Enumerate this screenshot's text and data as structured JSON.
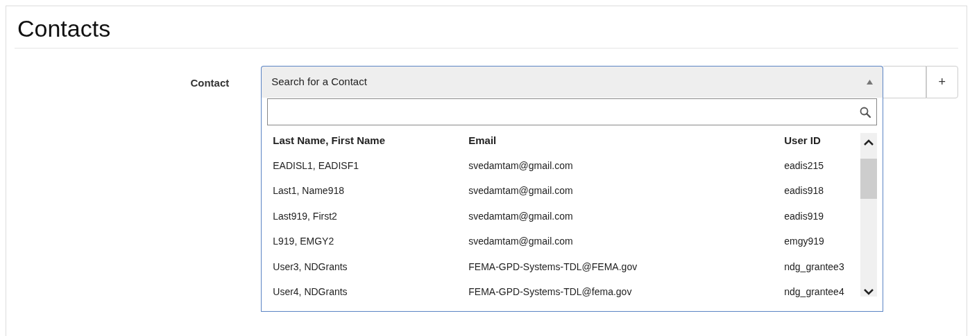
{
  "page": {
    "title": "Contacts"
  },
  "form": {
    "label": "Contact",
    "select": {
      "placeholder": "Search for a Contact",
      "expanded": true
    },
    "add_button": "+"
  },
  "dropdown": {
    "columns": [
      "Last Name, First Name",
      "Email",
      "User ID"
    ],
    "rows": [
      {
        "name": "EADISL1, EADISF1",
        "email": "svedamtam@gmail.com",
        "user_id": "eadis215"
      },
      {
        "name": "Last1, Name918",
        "email": "svedamtam@gmail.com",
        "user_id": "eadis918"
      },
      {
        "name": "Last919, First2",
        "email": "svedamtam@gmail.com",
        "user_id": "eadis919"
      },
      {
        "name": "L919, EMGY2",
        "email": "svedamtam@gmail.com",
        "user_id": "emgy919"
      },
      {
        "name": "User3, NDGrants",
        "email": "FEMA-GPD-Systems-TDL@FEMA.gov",
        "user_id": "ndg_grantee3"
      },
      {
        "name": "User4, NDGrants",
        "email": "FEMA-GPD-Systems-TDL@fema.gov",
        "user_id": "ndg_grantee4"
      }
    ]
  }
}
